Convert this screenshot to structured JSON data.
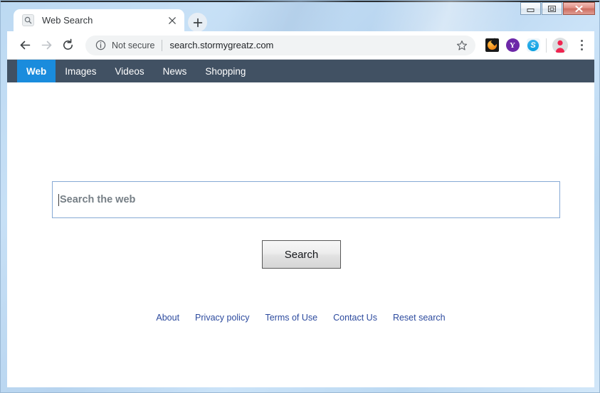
{
  "window": {
    "controls": {
      "minimize_label": "Minimize",
      "restore_label": "Restore",
      "close_label": "Close"
    }
  },
  "browser": {
    "tab": {
      "title": "Web Search",
      "favicon": "search-icon",
      "close_label": "×"
    },
    "new_tab_label": "+",
    "nav": {
      "back_label": "Back",
      "forward_label": "Forward",
      "reload_label": "Reload"
    },
    "omnibox": {
      "security_text": "Not secure",
      "url": "search.stormygreatz.com",
      "info_icon": "info-circle-icon",
      "star_icon": "bookmark-star-icon"
    },
    "extensions": [
      {
        "name": "orange-extension-icon",
        "label": ""
      },
      {
        "name": "yahoo-extension-icon",
        "label": "Y"
      },
      {
        "name": "skype-extension-icon",
        "label": "S"
      }
    ],
    "profile": {
      "icon": "profile-avatar-icon"
    },
    "menu": {
      "icon": "three-dot-menu-icon"
    }
  },
  "site": {
    "nav_items": [
      {
        "label": "Web",
        "active": true
      },
      {
        "label": "Images",
        "active": false
      },
      {
        "label": "Videos",
        "active": false
      },
      {
        "label": "News",
        "active": false
      },
      {
        "label": "Shopping",
        "active": false
      }
    ],
    "search": {
      "value": "",
      "placeholder": "Search the web",
      "button_label": "Search"
    },
    "footer_links": [
      "About",
      "Privacy policy",
      "Terms of Use",
      "Contact Us",
      "Reset search"
    ]
  },
  "colors": {
    "nav_bar": "#415163",
    "nav_active": "#1a8cdd",
    "link": "#2c4a9e",
    "frame": "#bcd9f2"
  }
}
